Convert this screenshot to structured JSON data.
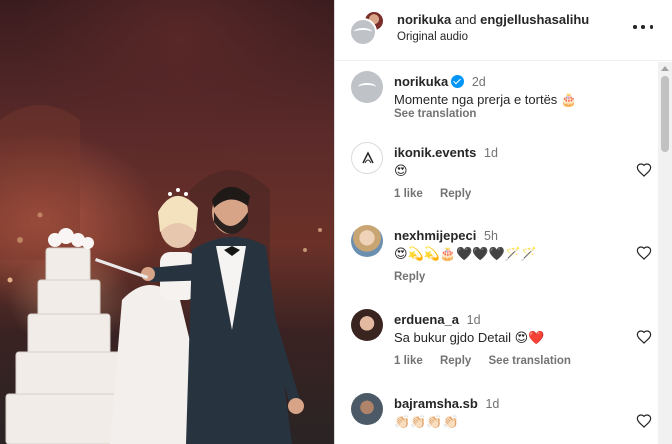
{
  "header": {
    "user1": "norikuka",
    "conjunction": "and",
    "user2": "engjellushasalihu",
    "audio": "Original audio",
    "more_icon": "more-horizontal-icon"
  },
  "caption": {
    "username": "norikuka",
    "verified": true,
    "time": "2d",
    "text": "Momente nga prerja e tortës 🎂",
    "see_translation": "See translation"
  },
  "comments": [
    {
      "username": "ikonik.events",
      "time": "1d",
      "text": "😍",
      "likes": "1 like",
      "reply": "Reply",
      "see_translation": ""
    },
    {
      "username": "nexhmijepeci",
      "time": "5h",
      "text": "😍💫💫🎂🖤🖤🖤🪄🪄",
      "likes": "",
      "reply": "Reply",
      "see_translation": ""
    },
    {
      "username": "erduena_a",
      "time": "1d",
      "text": "Sa bukur gjdo Detail 😍❤️",
      "likes": "1 like",
      "reply": "Reply",
      "see_translation": "See translation"
    },
    {
      "username": "bajramsha.sb",
      "time": "1d",
      "text": "👏🏻👏🏻👏🏻👏🏻",
      "likes": "",
      "reply": "",
      "see_translation": ""
    }
  ],
  "colors": {
    "link_gray": "#737373",
    "verified_blue": "#0095f6",
    "text": "#262626"
  }
}
